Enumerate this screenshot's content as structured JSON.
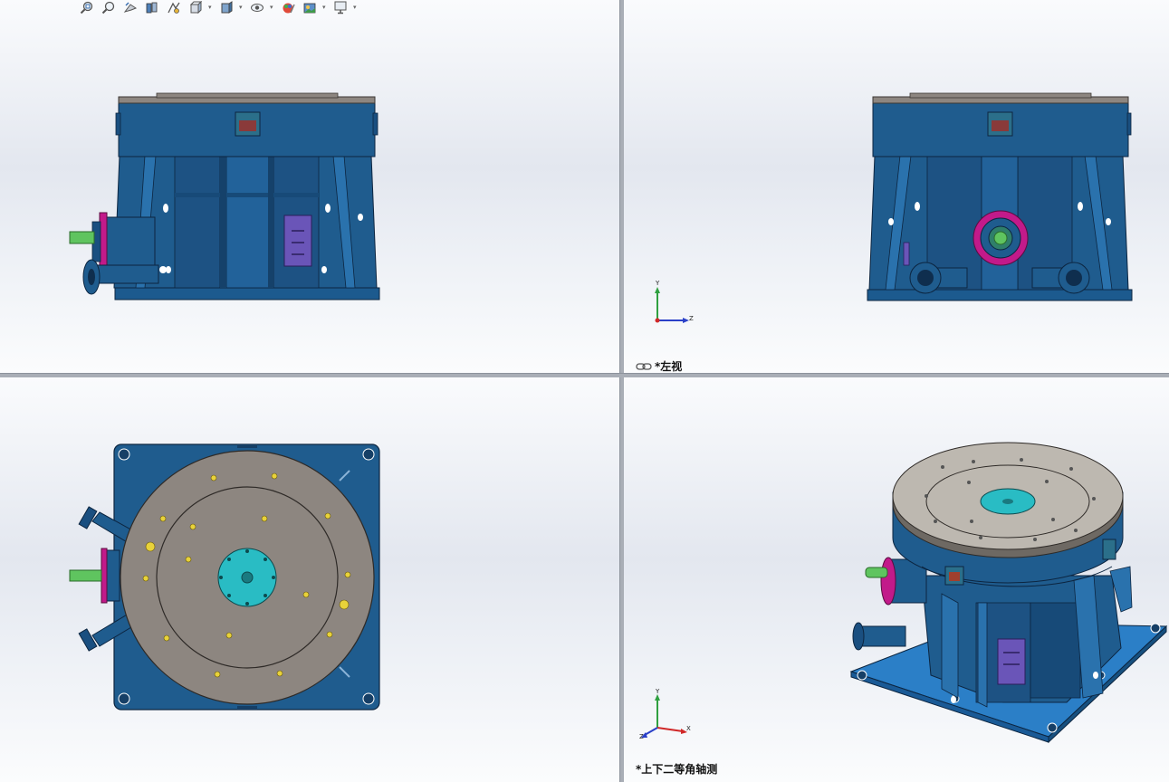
{
  "toolbar": {
    "items": [
      {
        "icon": "zoom-to-fit-icon"
      },
      {
        "icon": "zoom-to-area-icon"
      },
      {
        "icon": "previous-view-icon"
      },
      {
        "icon": "section-view-icon"
      },
      {
        "icon": "dynamic-annotation-icon"
      },
      {
        "icon": "view-orientation-icon",
        "dropdown": true
      },
      {
        "icon": "display-style-icon",
        "dropdown": true
      },
      {
        "icon": "hide-show-items-icon",
        "dropdown": true
      },
      {
        "icon": "edit-appearance-icon"
      },
      {
        "icon": "apply-scene-icon",
        "dropdown": true
      },
      {
        "icon": "view-settings-icon",
        "dropdown": true
      }
    ]
  },
  "viewports": {
    "top_left": {
      "label": ""
    },
    "top_right": {
      "label": "*左视",
      "triad": {
        "axis_1": "Y",
        "axis_2": "Z"
      }
    },
    "bottom_left": {
      "label": ""
    },
    "bottom_right": {
      "label": "*上下二等角轴测",
      "triad": {
        "axis_1": "Y",
        "axis_2": "X",
        "axis_3": "Z"
      }
    }
  },
  "colors": {
    "body_blue": "#1f5c8e",
    "dark_blue": "#163f66",
    "base_blue": "#2b7fc7",
    "top_plate_gray": "#8d8680",
    "flange_magenta": "#c21a8a",
    "hub_cyan": "#29bcc4",
    "shaft_green": "#5fc45f",
    "hole_yellow": "#e8d23a",
    "accent_purple": "#6a55b8"
  }
}
